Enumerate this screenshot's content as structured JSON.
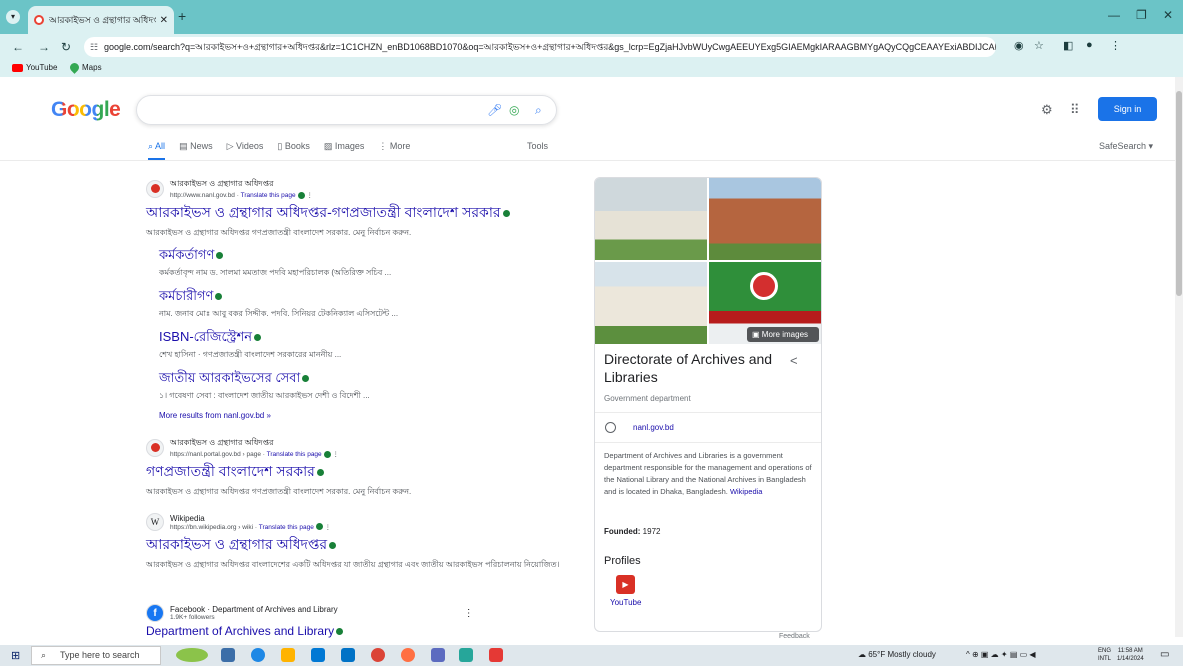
{
  "browser": {
    "tab_title": "আরকাইভস ও গ্রন্থাগার অধিদপ্ত",
    "url": "google.com/search?q=আরকাইভস+ও+গ্রন্থাগার+অধিদপ্তর&rlz=1C1CHZN_enBD1068BD1070&oq=আরকাইভস+ও+গ্রন্থাগার+অধিদপ্তর&gs_lcrp=EgZjaHJvbWUyCwgAEEUYExg5GIAEMgkIARAAGBMYgAQyCQgCEAAYExiABDIJCAMQABgTGIAEMgkIBBAAGBM...",
    "bookmarks": [
      "YouTube",
      "Maps"
    ]
  },
  "google": {
    "logo": "Google",
    "sign_in": "Sign in",
    "tabs": [
      "All",
      "News",
      "Videos",
      "Books",
      "Images",
      "More"
    ],
    "tab_icons": [
      "search-icon",
      "news-icon",
      "video-icon",
      "book-icon",
      "image-icon",
      "more-icon"
    ],
    "tools": "Tools",
    "safesearch": "SafeSearch ▾"
  },
  "results": [
    {
      "site": "আরকাইভস ও গ্রন্থাগার অধিদপ্তর",
      "url": "http://www.nanl.gov.bd",
      "translate": "Translate this page",
      "title": "আরকাইভস ও গ্রন্থাগার অধিদপ্তর-গণপ্রজাতন্ত্রী বাংলাদেশ সরকার",
      "snippet": "আরকাইভস ও গ্রন্থাগার অধিদপ্তর গণপ্রজাতন্ত্রী বাংলাদেশ সরকার. মেনু নির্বাচন করুন.",
      "sublinks": [
        {
          "title": "কর্মকর্তাগণ",
          "snippet": "কর্মকর্তাবৃন্দ নাম ড. সালমা মমতাজ পদবি মহাপরিচালক (অতিরিক্ত সচিব ..."
        },
        {
          "title": "কর্মচারীগণ",
          "snippet": "নাম. জনাব মোঃ আবু বকর সিদ্দীক. পদবি. সিনিয়র টেকনিক্যাল এসিসটেন্ট ..."
        },
        {
          "title": "ISBN-রেজিস্ট্রেশন",
          "snippet": "শেখ হাসিনা · গণপ্রজাতন্ত্রী বাংলাদেশ সরকারের মাননীয় ..."
        },
        {
          "title": "জাতীয় আরকাইভসের সেবা",
          "snippet": "১। গবেষণা সেবা : বাংলাদেশ জাতীয় আরকাইভস দেশী ও বিদেশী ..."
        }
      ],
      "more": "More results from nanl.gov.bd »"
    },
    {
      "site": "আরকাইভস ও গ্রন্থাগার অধিদপ্তর",
      "url": "https://nanl.portal.gov.bd › page",
      "translate": "Translate this page",
      "title": "গণপ্রজাতন্ত্রী বাংলাদেশ সরকার",
      "snippet": "আরকাইভস ও গ্রন্থাগার অধিদপ্তর গণপ্রজাতন্ত্রী বাংলাদেশ সরকার. মেনু নির্বাচন করুন."
    },
    {
      "site": "Wikipedia",
      "url": "https://bn.wikipedia.org › wiki",
      "translate": "Translate this page",
      "title": "আরকাইভস ও গ্রন্থাগার অধিদপ্তর",
      "snippet": "আরকাইভস ও গ্রন্থাগার অধিদপ্তর বাংলাদেশের একটি অধিদপ্তর যা জাতীয় গ্রন্থাগার এবং জাতীয় আরকাইভস পরিচালনায় নিয়োজিত।"
    },
    {
      "site": "Facebook · Department of Archives and Library",
      "url": "1.9K+ followers",
      "title": "Department of Archives and Library"
    }
  ],
  "knowledge_panel": {
    "more_images": "More images",
    "title": "Directorate of Archives and Libraries",
    "subtitle": "Government department",
    "website": "nanl.gov.bd",
    "description": "Department of Archives and Libraries is a government department responsible for the management and operations of the National Library and the National Archives in Bangladesh and is located in Dhaka, Bangladesh.",
    "wiki_link": "Wikipedia",
    "founded_label": "Founded:",
    "founded_value": "1972",
    "profiles_label": "Profiles",
    "youtube_label": "YouTube",
    "feedback": "Feedback"
  },
  "taskbar": {
    "search_placeholder": "Type here to search",
    "weather": "65°F  Mostly cloudy",
    "lang_top": "ENG",
    "lang_bottom": "INTL",
    "time": "11:58 AM",
    "date": "1/14/2024"
  }
}
